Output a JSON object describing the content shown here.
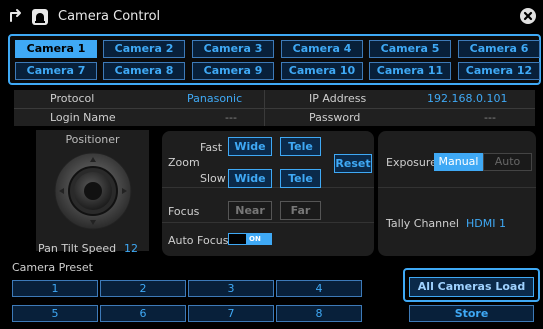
{
  "window": {
    "title": "Camera Control"
  },
  "cameras": [
    {
      "label": "Camera 1",
      "active": true
    },
    {
      "label": "Camera 2",
      "active": false
    },
    {
      "label": "Camera 3",
      "active": false
    },
    {
      "label": "Camera 4",
      "active": false
    },
    {
      "label": "Camera 5",
      "active": false
    },
    {
      "label": "Camera 6",
      "active": false
    },
    {
      "label": "Camera 7",
      "active": false
    },
    {
      "label": "Camera 8",
      "active": false
    },
    {
      "label": "Camera 9",
      "active": false
    },
    {
      "label": "Camera 10",
      "active": false
    },
    {
      "label": "Camera 11",
      "active": false
    },
    {
      "label": "Camera 12",
      "active": false
    }
  ],
  "info": {
    "protocol_label": "Protocol",
    "protocol_value": "Panasonic",
    "ip_label": "IP Address",
    "ip_value": "192.168.0.101",
    "login_label": "Login Name",
    "login_value": "---",
    "password_label": "Password",
    "password_value": "---"
  },
  "positioner": {
    "title": "Positioner",
    "pan_tilt_speed_label": "Pan Tilt Speed",
    "pan_tilt_speed_value": "12"
  },
  "zoom": {
    "label": "Zoom",
    "fast_label": "Fast",
    "slow_label": "Slow",
    "wide": "Wide",
    "tele": "Tele",
    "reset": "Reset"
  },
  "focus": {
    "label": "Focus",
    "near": "Near",
    "far": "Far"
  },
  "auto_focus": {
    "label": "Auto Focus",
    "state": "ON"
  },
  "exposure": {
    "label": "Exposure",
    "manual": "Manual",
    "auto": "Auto",
    "selected": "Manual"
  },
  "tally": {
    "label": "Tally Channel",
    "value": "HDMI 1"
  },
  "presets": {
    "title": "Camera Preset",
    "items": [
      "1",
      "2",
      "3",
      "4",
      "5",
      "6",
      "7",
      "8"
    ],
    "load_all": "All Cameras Load",
    "store": "Store"
  },
  "colors": {
    "accent": "#3fa9f5",
    "panel": "#1e1e1e",
    "background": "#000000"
  }
}
